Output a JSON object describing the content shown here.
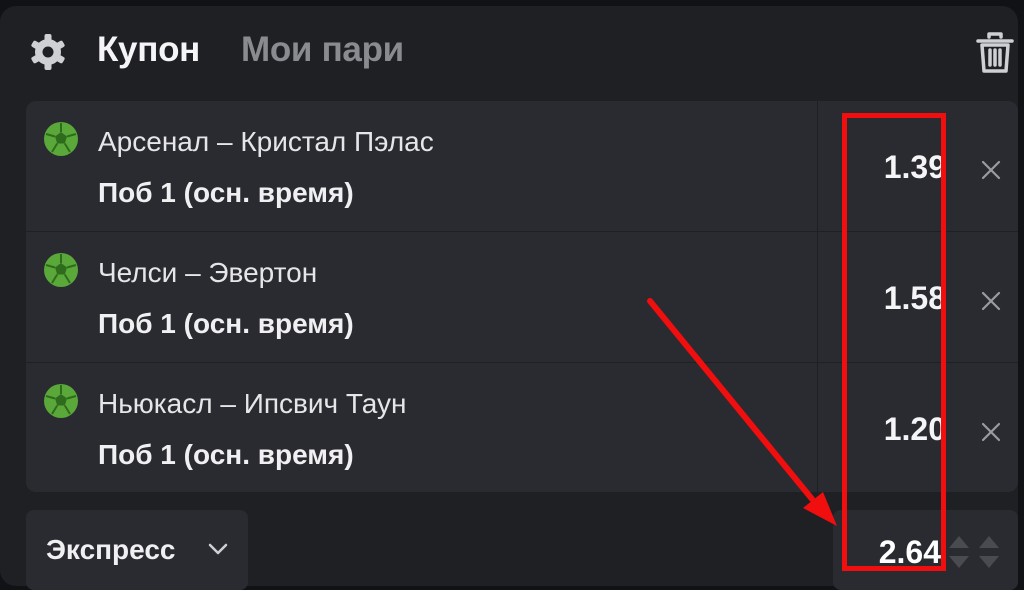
{
  "header": {
    "tab_active": "Купон",
    "tab_inactive": "Мои пари",
    "settings_icon": "gear-icon",
    "clear_icon": "trash-icon"
  },
  "bets": [
    {
      "match": "Арсенал – Кристал Пэлас",
      "market": "Поб 1 (осн. время)",
      "odd": "1.39",
      "sport_icon": "football-icon"
    },
    {
      "match": "Челси – Эвертон",
      "market": "Поб 1 (осн. время)",
      "odd": "1.58",
      "sport_icon": "football-icon"
    },
    {
      "match": "Ньюкасл – Ипсвич Таун",
      "market": "Поб 1 (осн. время)",
      "odd": "1.20",
      "sport_icon": "football-icon"
    }
  ],
  "footer": {
    "bet_type": "Экспресс",
    "total_odd": "2.64"
  },
  "colors": {
    "panel": "#1f2024",
    "card": "#2a2b30",
    "ball_green": "#5aa83a",
    "annotation_red": "#f00e0e"
  }
}
